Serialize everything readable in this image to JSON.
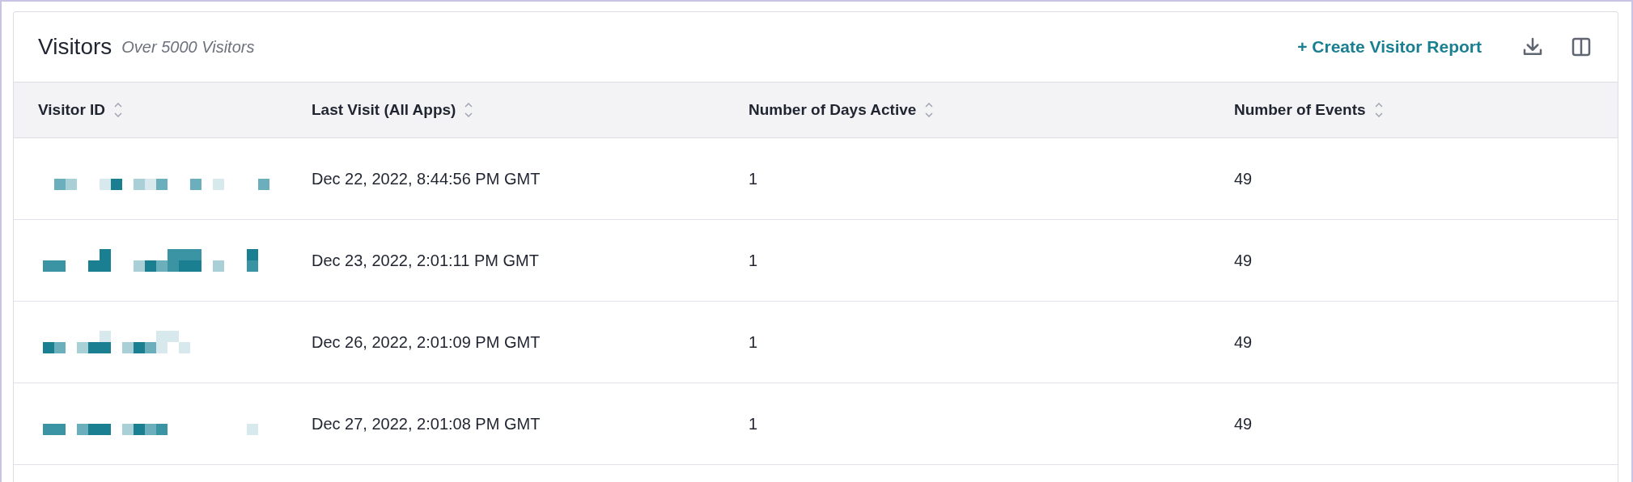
{
  "panel": {
    "title": "Visitors",
    "subtitle": "Over 5000 Visitors",
    "create_link": "+ Create Visitor Report"
  },
  "table": {
    "columns": [
      {
        "label": "Visitor ID",
        "sortable": true
      },
      {
        "label": "Last Visit (All Apps)",
        "sortable": true
      },
      {
        "label": "Number of Days Active",
        "sortable": true
      },
      {
        "label": "Number of Events",
        "sortable": true
      }
    ],
    "rows": [
      {
        "visitor_id": {
          "kind": "redacted"
        },
        "last_visit": "Dec 22, 2022, 8:44:56 PM GMT",
        "days_active": "1",
        "events": "49"
      },
      {
        "visitor_id": {
          "kind": "redacted"
        },
        "last_visit": "Dec 23, 2022, 2:01:11 PM GMT",
        "days_active": "1",
        "events": "49"
      },
      {
        "visitor_id": {
          "kind": "redacted"
        },
        "last_visit": "Dec 26, 2022, 2:01:09 PM GMT",
        "days_active": "1",
        "events": "49"
      },
      {
        "visitor_id": {
          "kind": "redacted"
        },
        "last_visit": "Dec 27, 2022, 2:01:08 PM GMT",
        "days_active": "1",
        "events": "49"
      }
    ]
  }
}
